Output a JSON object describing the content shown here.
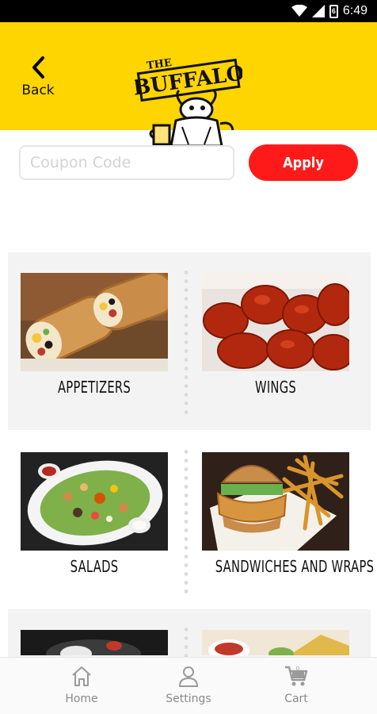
{
  "status_bar": {
    "time": "6:49",
    "battery_level": "6"
  },
  "header": {
    "back_label": "Back",
    "logo_the": "THE",
    "logo_name": "BUFFALO",
    "brand_color": "#ffd500"
  },
  "coupon": {
    "placeholder": "Coupon Code",
    "value": "",
    "apply_label": "Apply",
    "apply_color": "#ff1a1a"
  },
  "categories": [
    {
      "label": "APPETIZERS"
    },
    {
      "label": "WINGS"
    },
    {
      "label": "SALADS"
    },
    {
      "label": "SANDWICHES AND WRAPS"
    },
    {
      "label": ""
    },
    {
      "label": ""
    }
  ],
  "nav": {
    "items": [
      {
        "label": "Home",
        "icon": "home-icon"
      },
      {
        "label": "Settings",
        "icon": "person-icon"
      },
      {
        "label": "Cart",
        "icon": "cart-icon"
      }
    ]
  }
}
